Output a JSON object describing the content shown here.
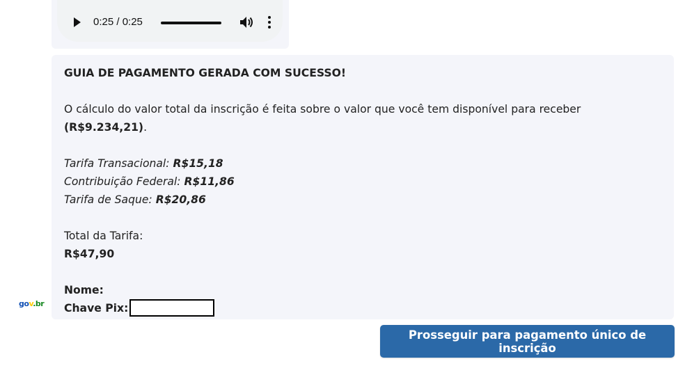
{
  "audio": {
    "time": "0:25 / 0:25",
    "progress": 1.0,
    "icons": [
      "play-icon",
      "volume-icon",
      "more-options-icon"
    ]
  },
  "message": {
    "title": "GUIA DE PAGAMENTO GERADA COM SUCESSO!",
    "intro": "O cálculo do valor total da inscrição é feita sobre o valor que você tem disponível para receber",
    "available_amount": "(R$9.234,21)",
    "available_suffix": ".",
    "fees": [
      {
        "label": "Tarifa Transacional: ",
        "value": "R$15,18"
      },
      {
        "label": "Contribuição Federal: ",
        "value": "R$11,86"
      },
      {
        "label": "Tarifa de Saque: ",
        "value": "R$20,86"
      }
    ],
    "total_label": "Total da Tarifa:",
    "total_value": "R$47,90",
    "name_label": "Nome:",
    "pix_label": "Chave Pix:"
  },
  "logo": {
    "part1": "go",
    "part2": "v",
    "part3": ".br"
  },
  "actions": {
    "proceed_label": "Prosseguir para pagamento único de inscrição"
  },
  "colors": {
    "button_bg": "#2b69a8",
    "bubble_bg": "#f4f5fa"
  }
}
